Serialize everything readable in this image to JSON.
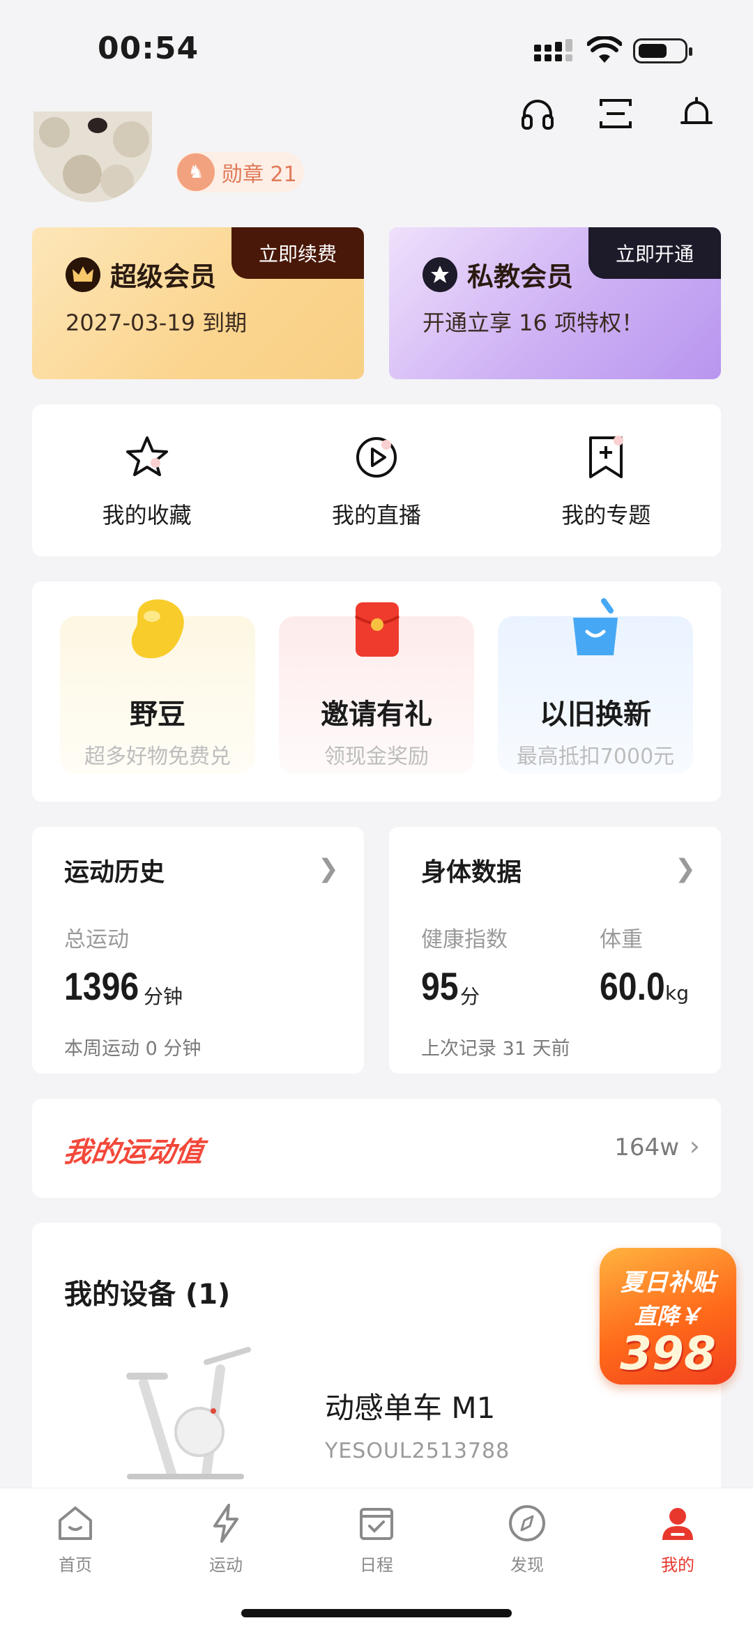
{
  "status_bar": {
    "time": "00:54"
  },
  "profile": {
    "badge_label": "勋章 21"
  },
  "membership": [
    {
      "title": "超级会员",
      "subtitle": "2027-03-19 到期",
      "action": "立即续费"
    },
    {
      "title": "私教会员",
      "subtitle": "开通立享 16 项特权！",
      "action": "立即开通"
    }
  ],
  "shortcuts": [
    {
      "label": "我的收藏",
      "icon": "star-icon"
    },
    {
      "label": "我的直播",
      "icon": "play-icon"
    },
    {
      "label": "我的专题",
      "icon": "bookmark-plus-icon"
    }
  ],
  "promos": [
    {
      "title": "野豆",
      "subtitle": "超多好物免费兑",
      "icon": "bean-icon"
    },
    {
      "title": "邀请有礼",
      "subtitle": "领现金奖励",
      "icon": "red-envelope-icon"
    },
    {
      "title": "以旧换新",
      "subtitle": "最高抵扣7000元",
      "icon": "basket-icon"
    }
  ],
  "sport_history": {
    "title": "运动历史",
    "total_label": "总运动",
    "total_value": "1396",
    "total_unit": "分钟",
    "week_note": "本周运动 0 分钟"
  },
  "body_data": {
    "title": "身体数据",
    "health_label": "健康指数",
    "health_value": "95",
    "health_unit": "分",
    "weight_label": "体重",
    "weight_value": "60.0",
    "weight_unit": "kg",
    "last_record": "上次记录 31 天前"
  },
  "sport_value": {
    "title": "我的运动值",
    "value": "164w"
  },
  "devices": {
    "title": "我的设备 (1)",
    "items": [
      {
        "name": "动感单车 M1",
        "serial": "YESOUL2513788"
      }
    ]
  },
  "float_ad": {
    "line1": "夏日补贴",
    "line2": "直降￥",
    "line3": "398"
  },
  "tabs": [
    {
      "label": "首页",
      "icon": "home-icon"
    },
    {
      "label": "运动",
      "icon": "lightning-icon"
    },
    {
      "label": "日程",
      "icon": "calendar-icon"
    },
    {
      "label": "发现",
      "icon": "compass-icon"
    },
    {
      "label": "我的",
      "icon": "profile-icon"
    }
  ],
  "colors": {
    "accent": "#e8382e",
    "vip_gold": "#fbd58f",
    "coach_purple": "#b896ef"
  }
}
